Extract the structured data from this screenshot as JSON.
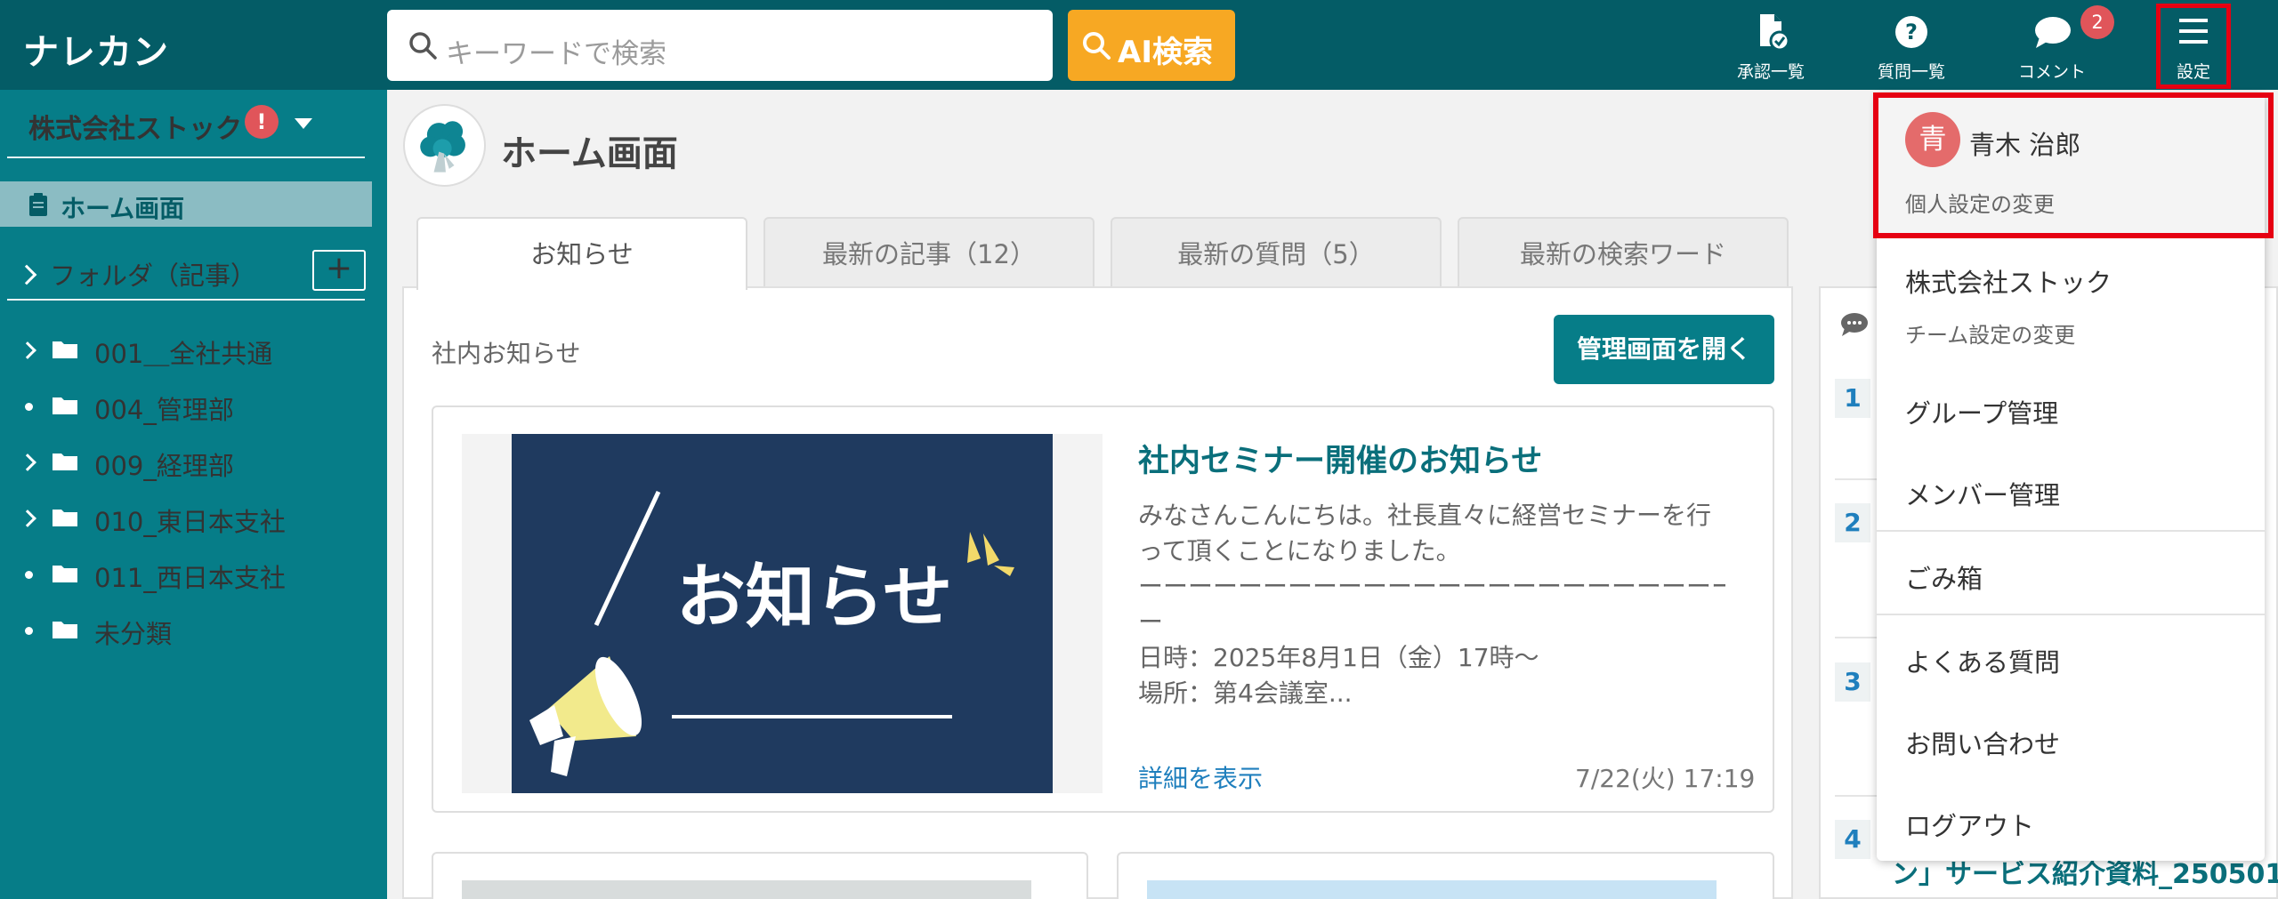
{
  "app": {
    "logo": "ナレカン"
  },
  "search": {
    "placeholder": "キーワードで検索",
    "ai_button": "AI検索"
  },
  "header_nav": [
    {
      "label": "承認一覧",
      "icon": "approval-document-icon"
    },
    {
      "label": "質問一覧",
      "icon": "question-circle-icon"
    },
    {
      "label": "コメント",
      "icon": "comment-bubble-icon",
      "badge": "2"
    },
    {
      "label": "設定",
      "icon": "hamburger-menu-icon"
    }
  ],
  "sidebar": {
    "company": "株式会社ストック",
    "company_alert": "!",
    "home": "ホーム画面",
    "folders_heading": "フォルダ（記事）",
    "add_symbol": "+",
    "folders": [
      {
        "label": "001＿全社共通",
        "marker": "chevron"
      },
      {
        "label": "004_管理部",
        "marker": "dot"
      },
      {
        "label": "009_経理部",
        "marker": "chevron"
      },
      {
        "label": "010_東日本支社",
        "marker": "chevron"
      },
      {
        "label": "011_西日本支社",
        "marker": "dot"
      },
      {
        "label": "未分類",
        "marker": "dot"
      }
    ]
  },
  "main": {
    "title": "ホーム画面",
    "tabs": [
      "お知らせ",
      "最新の記事（12）",
      "最新の質問（5）",
      "最新の検索ワード"
    ],
    "section_label": "社内お知らせ",
    "admin_button": "管理画面を開く",
    "notice": {
      "image_text": "お知らせ",
      "title": "社内セミナー開催のお知らせ",
      "body_lines": [
        "みなさんこんにちは。社長直々に経営セミナーを行",
        "って頂くことになりました。",
        "ーーーーーーーーーーーーーーーーーーーーーーーー",
        "ー",
        "日時：2025年8月1日（金）17時〜",
        "場所：第4会議室..."
      ],
      "link": "詳細を表示",
      "date": "7/22(火) 17:19"
    }
  },
  "right_panel": {
    "ranks": [
      "1",
      "2",
      "3",
      "4"
    ],
    "peek_text": "ン」サービス紹介資料_250501"
  },
  "dropdown": {
    "avatar_char": "青",
    "user_name": "青木 治郎",
    "personal_settings": "個人設定の変更",
    "team_name": "株式会社ストック",
    "team_settings": "チーム設定の変更",
    "items": [
      "グループ管理",
      "メンバー管理",
      "ごみ箱",
      "よくある質問",
      "お問い合わせ",
      "ログアウト"
    ]
  },
  "colors": {
    "header": "#045c66",
    "sidebar": "#067d88",
    "accent_orange": "#f7a823",
    "highlight_red": "#e60012",
    "badge_red": "#e0555a"
  }
}
